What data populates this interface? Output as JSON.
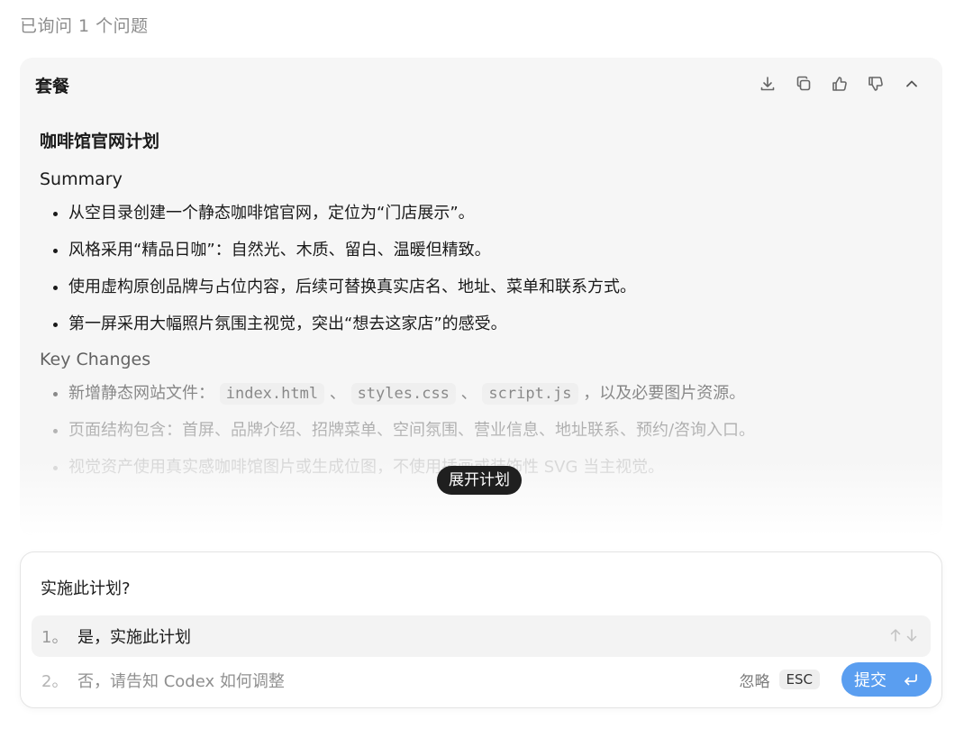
{
  "status": {
    "text": "已询问 1 个问题"
  },
  "plan": {
    "title": "套餐",
    "actions": [
      {
        "name": "download-icon"
      },
      {
        "name": "copy-icon"
      },
      {
        "name": "thumbs-up-icon"
      },
      {
        "name": "thumbs-down-icon"
      },
      {
        "name": "chevron-up-icon"
      }
    ],
    "doc_title": "咖啡馆官网计划",
    "summary": {
      "title": "Summary",
      "items": [
        "从空目录创建一个静态咖啡馆官网，定位为“门店展示”。",
        "风格采用“精品日咖”：自然光、木质、留白、温暖但精致。",
        "使用虚构原创品牌与占位内容，后续可替换真实店名、地址、菜单和联系方式。",
        "第一屏采用大幅照片氛围主视觉，突出“想去这家店”的感受。"
      ]
    },
    "key_changes": {
      "title": "Key Changes",
      "item1_prefix": "新增静态网站文件：",
      "file1": "index.html",
      "sep1": "、",
      "file2": "styles.css",
      "sep2": "、",
      "file3": "script.js",
      "item1_suffix": "，以及必要图片资源。",
      "item2": "页面结构包含：首屏、品牌介绍、招牌菜单、空间氛围、营业信息、地址联系、预约/咨询入口。",
      "item3": "视觉资产使用真实感咖啡馆图片或生成位图，不使用插画或装饰性 SVG 当主视觉。"
    },
    "expand_label": "展开计划"
  },
  "question": {
    "title": "实施此计划?",
    "options": [
      {
        "num": "1。",
        "label": "是，实施此计划"
      },
      {
        "num": "2。",
        "label": "否，请告知 Codex 如何调整"
      }
    ],
    "ignore_label": "忽略",
    "esc_label": "ESC",
    "submit_label": "提交"
  },
  "colors": {
    "accent": "#5a9ef0",
    "card_bg": "#f6f6f6",
    "pill_bg": "#1f1f1f"
  }
}
